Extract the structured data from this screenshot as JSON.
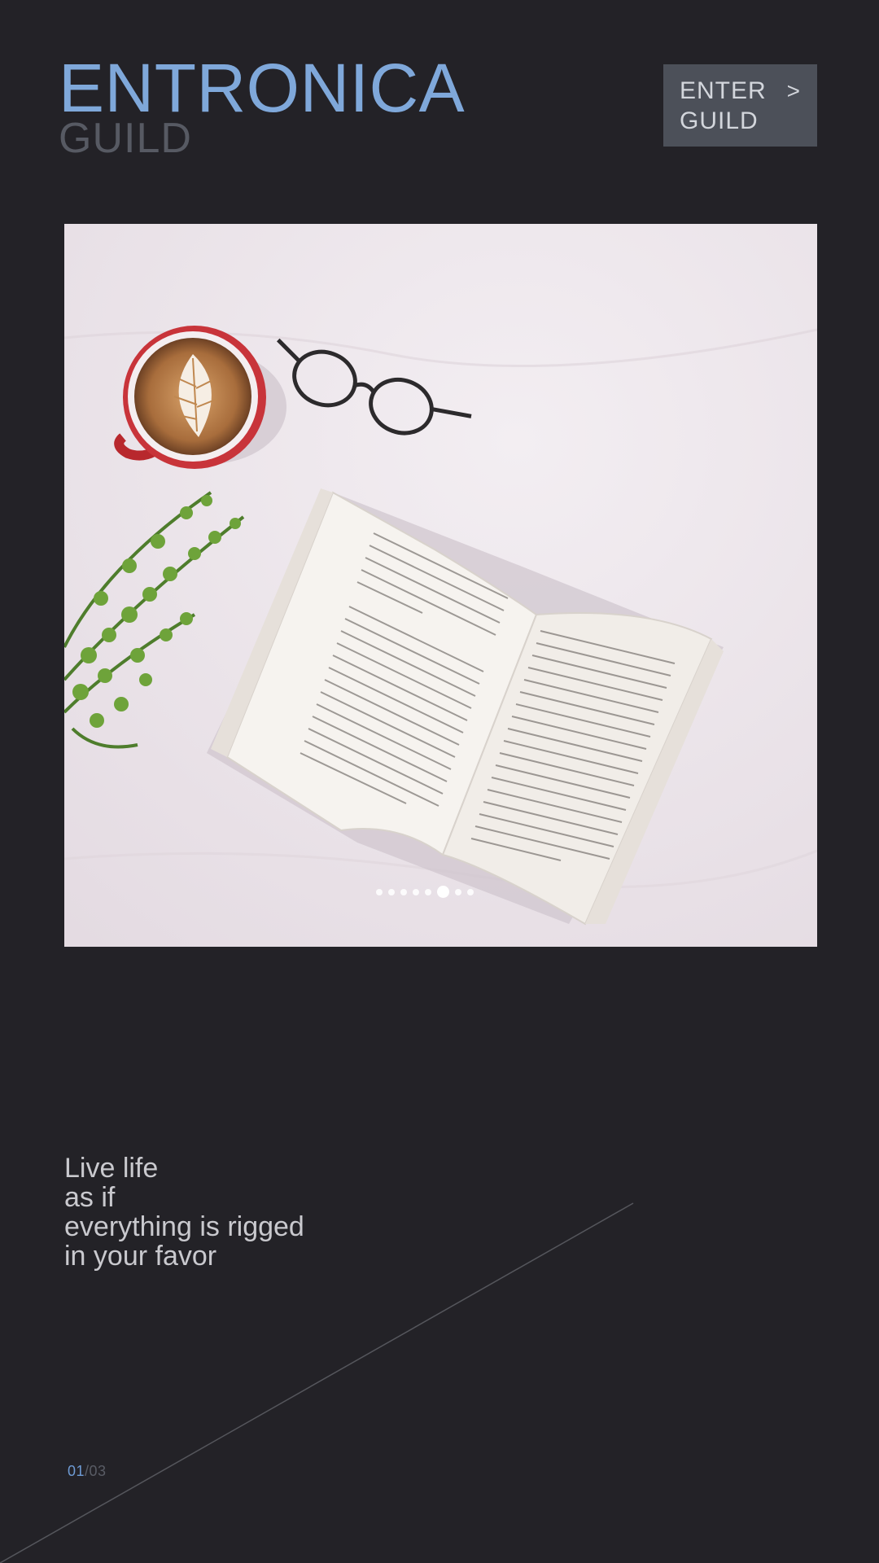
{
  "brand": {
    "title": "ENTRONICA",
    "subtitle": "GUILD"
  },
  "enter_button": {
    "line1": "ENTER",
    "line2": "GUILD",
    "arrow": ">"
  },
  "hero": {
    "image_description_icon": "coffee-book-glasses-plant-photo",
    "slides_count": 8,
    "active_slide": 5
  },
  "quote": {
    "lines": [
      "Live life",
      "as if",
      "everything is rigged",
      "in your favor"
    ]
  },
  "pager": {
    "current": "01",
    "separator": "/",
    "total": "03"
  },
  "colors": {
    "background": "#232227",
    "accent": "#7fa8da",
    "muted": "#575a63",
    "button_bg": "#4c5059"
  }
}
